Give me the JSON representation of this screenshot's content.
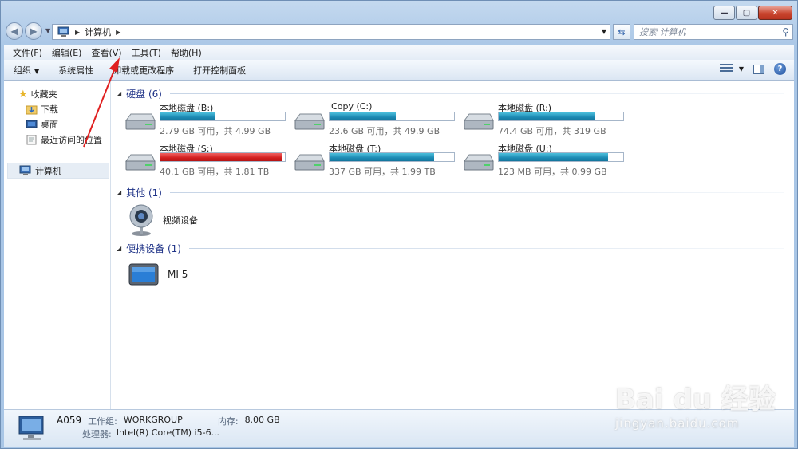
{
  "window": {
    "caption_buttons": [
      "minimize",
      "maximize",
      "close"
    ]
  },
  "address_bar": {
    "path": "计算机",
    "search_placeholder": "搜索 计算机"
  },
  "menu": [
    "文件(F)",
    "编辑(E)",
    "查看(V)",
    "工具(T)",
    "帮助(H)"
  ],
  "commands": [
    "组织",
    "系统属性",
    "卸载或更改程序",
    "打开控制面板"
  ],
  "nav": {
    "favorites": "收藏夹",
    "downloads": "下载",
    "desktop": "桌面",
    "recent": "最近访问的位置",
    "computer": "计算机"
  },
  "groups": {
    "hard_disks": "硬盘 (6)",
    "other": "其他 (1)",
    "portable": "便携设备 (1)"
  },
  "drives": [
    {
      "name": "本地磁盘 (B:)",
      "info": "2.79 GB 可用，共 4.99 GB",
      "used_fraction": 0.44,
      "color": "#1c8ab3"
    },
    {
      "name": "iCopy (C:)",
      "info": "23.6 GB 可用，共 49.9 GB",
      "used_fraction": 0.53,
      "color": "#1c8ab3"
    },
    {
      "name": "本地磁盘 (R:)",
      "info": "74.4 GB 可用，共 319 GB",
      "used_fraction": 0.77,
      "color": "#1c8ab3"
    },
    {
      "name": "本地磁盘 (S:)",
      "info": "40.1 GB 可用，共 1.81 TB",
      "used_fraction": 0.98,
      "color": "#d11e1e"
    },
    {
      "name": "本地磁盘 (T:)",
      "info": "337 GB 可用，共 1.99 TB",
      "used_fraction": 0.84,
      "color": "#1c8ab3"
    },
    {
      "name": "本地磁盘 (U:)",
      "info": "123 MB 可用，共 0.99 GB",
      "used_fraction": 0.88,
      "color": "#1c8ab3"
    }
  ],
  "other_devices": [
    "视频设备"
  ],
  "portable_devices": [
    "MI 5"
  ],
  "details": {
    "computer_name": "A059",
    "workgroup_label": "工作组:",
    "workgroup": "WORKGROUP",
    "memory_label": "内存:",
    "memory": "8.00 GB",
    "processor_label": "处理器:",
    "processor": "Intel(R) Core(TM) i5-6..."
  },
  "watermark": {
    "logo": "Bai du 经验",
    "url": "jingyan.baidu.com"
  }
}
